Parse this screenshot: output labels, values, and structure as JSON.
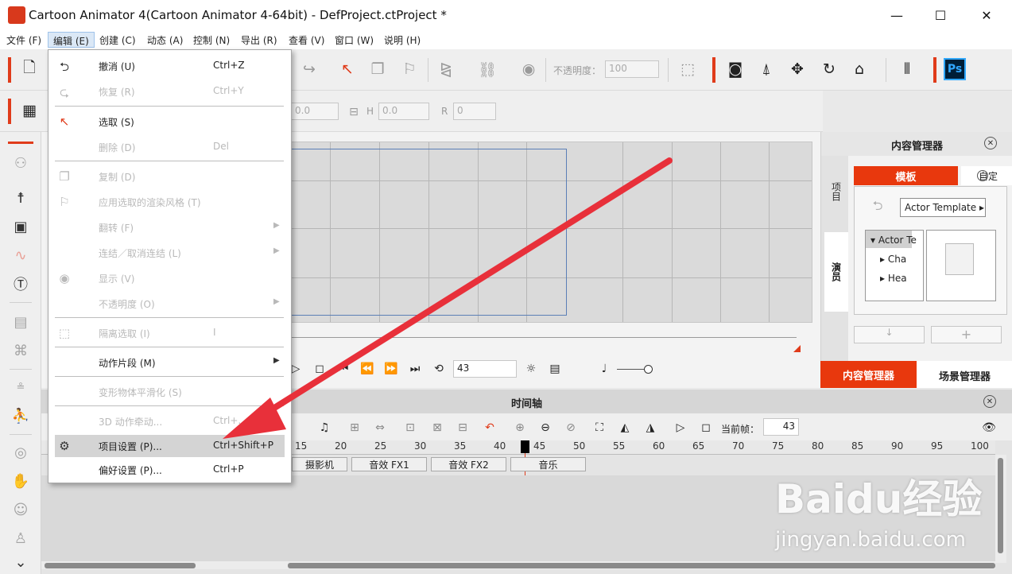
{
  "window": {
    "title": "Cartoon Animator 4(Cartoon Animator 4-64bit) - DefProject.ctProject *",
    "minimize": "—",
    "maximize": "☐",
    "close": "✕"
  },
  "menubar": [
    "文件 (F)",
    "编辑 (E)",
    "创建 (C)",
    "动态 (A)",
    "控制 (N)",
    "导出 (R)",
    "查看 (V)",
    "窗口 (W)",
    "说明 (H)"
  ],
  "toolbar": {
    "opacity_label": "不透明度：",
    "opacity_value": "100",
    "ps_label": "Ps"
  },
  "transform": {
    "x_value": "0.0",
    "h_label": "H",
    "h_value": "0.0",
    "r_label": "R",
    "r_value": "0"
  },
  "edit_menu": [
    {
      "label": "撤消 (U)",
      "shortcut": "Ctrl+Z",
      "icon": "undo-icon",
      "glyph": "⮌",
      "enabled": true
    },
    {
      "label": "恢复 (R)",
      "shortcut": "Ctrl+Y",
      "icon": "redo-icon",
      "glyph": "⮎",
      "enabled": false
    },
    {
      "label": "选取 (S)",
      "shortcut": "",
      "icon": "select-arrow-icon",
      "glyph": "↖",
      "enabled": true
    },
    {
      "label": "删除 (D)",
      "shortcut": "Del",
      "icon": "",
      "glyph": "",
      "enabled": false
    },
    {
      "label": "复制 (D)",
      "shortcut": "",
      "icon": "duplicate-icon",
      "glyph": "❐",
      "enabled": false
    },
    {
      "label": "应用选取的渲染风格 (T)",
      "shortcut": "",
      "icon": "render-style-icon",
      "glyph": "⚐",
      "enabled": false
    },
    {
      "label": "翻转 (F)",
      "shortcut": "",
      "icon": "",
      "glyph": "",
      "enabled": false,
      "submenu": true
    },
    {
      "label": "连结／取消连结 (L)",
      "shortcut": "",
      "icon": "",
      "glyph": "",
      "enabled": false,
      "submenu": true
    },
    {
      "label": "显示 (V)",
      "shortcut": "",
      "icon": "eye-icon",
      "glyph": "◉",
      "enabled": false
    },
    {
      "label": "不透明度 (O)",
      "shortcut": "",
      "icon": "",
      "glyph": "",
      "enabled": false,
      "submenu": true
    },
    {
      "label": "隔离选取 (I)",
      "shortcut": "I",
      "icon": "isolate-icon",
      "glyph": "⬚",
      "enabled": false
    },
    {
      "label": "动作片段 (M)",
      "shortcut": "",
      "icon": "",
      "glyph": "",
      "enabled": true,
      "submenu": true
    },
    {
      "label": "变形物体平滑化 (S)",
      "shortcut": "",
      "icon": "",
      "glyph": "",
      "enabled": false
    },
    {
      "label": "3D 动作牵动...",
      "shortcut": "Ctrl+...",
      "icon": "",
      "glyph": "",
      "enabled": false
    },
    {
      "label": "项目设置 (P)...",
      "shortcut": "Ctrl+Shift+P",
      "icon": "gear-icon",
      "glyph": "⚙",
      "enabled": true,
      "highlighted": true
    },
    {
      "label": "偏好设置 (P)...",
      "shortcut": "Ctrl+P",
      "icon": "",
      "glyph": "",
      "enabled": true
    }
  ],
  "playback": {
    "frame_value": "43"
  },
  "content_manager": {
    "title": "内容管理器",
    "tab_project": "项目",
    "tab_actor": "演员",
    "template_tab": "模板",
    "custom_tab": "自定",
    "template_dropdown": "Actor Template ▸",
    "tree": [
      "Actor Te",
      "Cha",
      "Hea"
    ],
    "bottom_tab_active": "内容管理器",
    "bottom_tab_other": "场景管理器"
  },
  "timeline": {
    "title": "时间轴",
    "current_frame_label": "当前帧：",
    "current_frame_value": "43",
    "ruler": [
      "15",
      "20",
      "25",
      "30",
      "35",
      "40",
      "45",
      "50",
      "55",
      "60",
      "65",
      "70",
      "75",
      "80",
      "85",
      "90",
      "95",
      "100"
    ],
    "tracks": [
      "摄影机",
      "音效 FX1",
      "音效 FX2",
      "音乐"
    ]
  },
  "watermark": {
    "brand": "Baidu经验",
    "url": "jingyan.baidu.com"
  },
  "colors": {
    "accent": "#e03b1a",
    "arrow": "#e8303a"
  }
}
